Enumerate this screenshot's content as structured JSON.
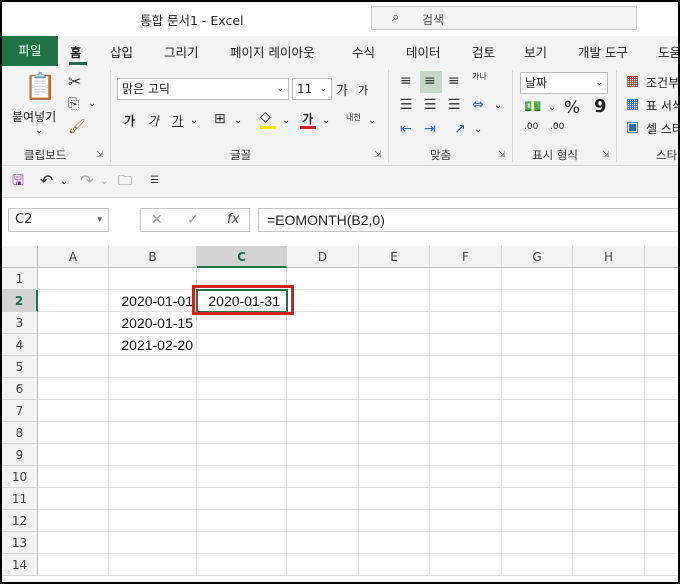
{
  "title_bar": {
    "title": "통합 문서1  -  Excel",
    "search_placeholder": "검색",
    "search_icon": "search-icon"
  },
  "tabs": [
    "파일",
    "홈",
    "삽입",
    "그리기",
    "페이지 레이아웃",
    "수식",
    "데이터",
    "검토",
    "보기",
    "개발 도구",
    "도움"
  ],
  "active_tab": "홈",
  "ribbon": {
    "clipboard": {
      "paste_label": "붙여넣기",
      "group_label": "클립보드"
    },
    "font": {
      "font_name": "맑은 고딕",
      "font_size": "11",
      "grow_label": "가",
      "shrink_label": "가",
      "bold": "가",
      "italic": "가",
      "underline": "가",
      "font_color_letter": "가",
      "phonetic_label": "내천",
      "group_label": "글꼴"
    },
    "alignment": {
      "wrap_label": "가나",
      "group_label": "맞춤"
    },
    "number": {
      "format": "날짜",
      "percent": "%",
      "comma": "9",
      "inc_decimal": ".00",
      "dec_decimal": ".00",
      "group_label": "표시 형식"
    },
    "styles": {
      "cond_format": "조건부",
      "format_table": "표 서식",
      "cell_styles": "셀 스타",
      "group_label": "스타"
    }
  },
  "formula_bar": {
    "name_box": "C2",
    "formula": "=EOMONTH(B2,0)",
    "fx_label": "fx"
  },
  "columns": [
    "A",
    "B",
    "C",
    "D",
    "E",
    "F",
    "G",
    "H"
  ],
  "rows": [
    "1",
    "2",
    "3",
    "4",
    "5",
    "6",
    "7",
    "8",
    "9",
    "10",
    "11",
    "12",
    "13",
    "14"
  ],
  "cells": {
    "B2": "2020-01-01",
    "B3": "2020-01-15",
    "B4": "2021-02-20",
    "C2": "2020-01-31"
  },
  "colors": {
    "accent": "#217346",
    "highlight_box": "#d32020",
    "font_color_bar": "#d32020",
    "fill_color_bar": "#ffe600"
  }
}
